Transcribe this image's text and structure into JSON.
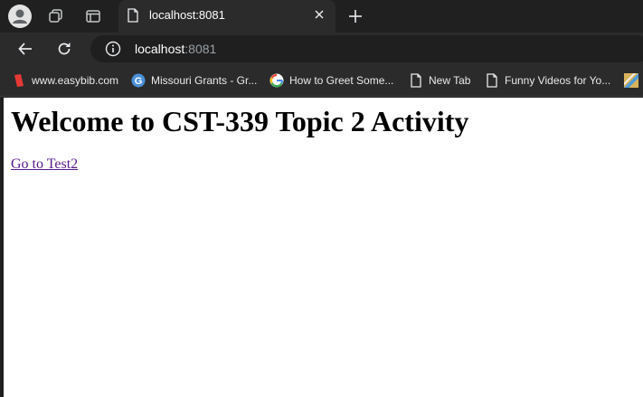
{
  "browser": {
    "tab": {
      "title": "localhost:8081"
    },
    "address": {
      "host": "localhost",
      "port": ":8081"
    },
    "bookmarks": [
      {
        "label": "www.easybib.com",
        "icon": "easybib-icon"
      },
      {
        "label": "Missouri Grants - Gr...",
        "icon": "google-favicon-icon"
      },
      {
        "label": "How to Greet Some...",
        "icon": "google-favicon-icon"
      },
      {
        "label": "New Tab",
        "icon": "page-icon"
      },
      {
        "label": "Funny Videos for Yo...",
        "icon": "page-icon"
      }
    ]
  },
  "page": {
    "heading": "Welcome to CST-339 Topic 2 Activity",
    "link_text": "Go to Test2"
  },
  "colors": {
    "chrome_dark": "#202020",
    "toolbar": "#2b2b2b",
    "visited_link": "#551a8b"
  }
}
